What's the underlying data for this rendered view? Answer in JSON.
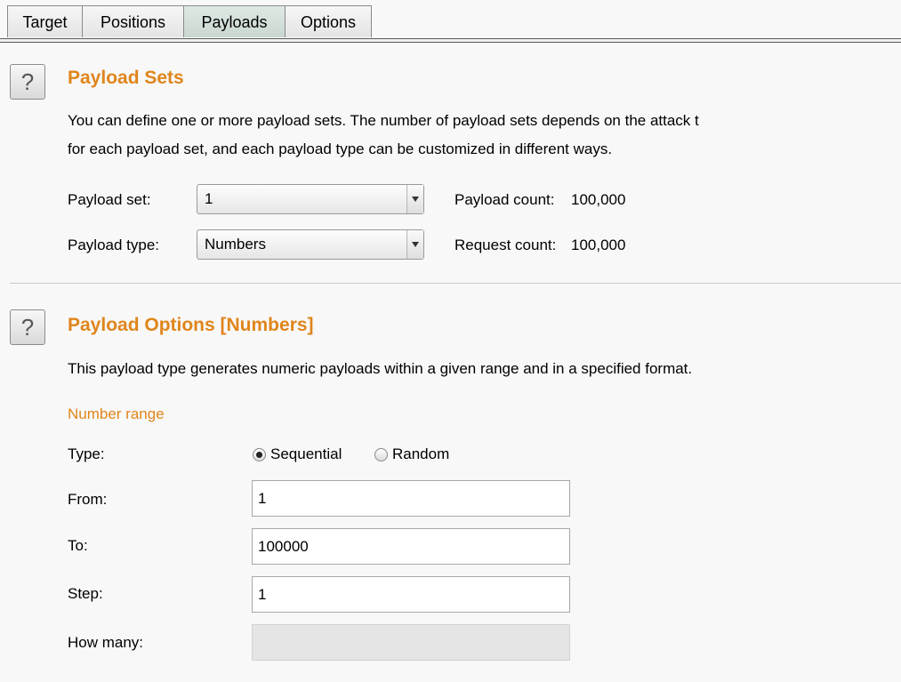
{
  "tabs": [
    {
      "label": "Target"
    },
    {
      "label": "Positions"
    },
    {
      "label": "Payloads"
    },
    {
      "label": "Options"
    }
  ],
  "selected_tab": "Payloads",
  "help_icon_glyph": "?",
  "payload_sets": {
    "title": "Payload Sets",
    "description_line1": "You can define one or more payload sets. The number of payload sets depends on the attack t",
    "description_line2": "for each payload set, and each payload type can be customized in different ways.",
    "payload_set_label": "Payload set:",
    "payload_set_value": "1",
    "payload_type_label": "Payload type:",
    "payload_type_value": "Numbers",
    "payload_count_label": "Payload count:",
    "payload_count_value": "100,000",
    "request_count_label": "Request count:",
    "request_count_value": "100,000"
  },
  "payload_options": {
    "title": "Payload Options [Numbers]",
    "description": "This payload type generates numeric payloads within a given range and in a specified format.",
    "number_range_heading": "Number range",
    "type_label": "Type:",
    "type_options": [
      "Sequential",
      "Random"
    ],
    "type_selected": "Sequential",
    "from_label": "From:",
    "from_value": "1",
    "to_label": "To:",
    "to_value": "100000",
    "step_label": "Step:",
    "step_value": "1",
    "how_many_label": "How many:",
    "how_many_value": ""
  },
  "colors": {
    "accent_orange": "#e0851c",
    "background": "#f8f8f8",
    "selected_tab": "#c9d7d0"
  }
}
